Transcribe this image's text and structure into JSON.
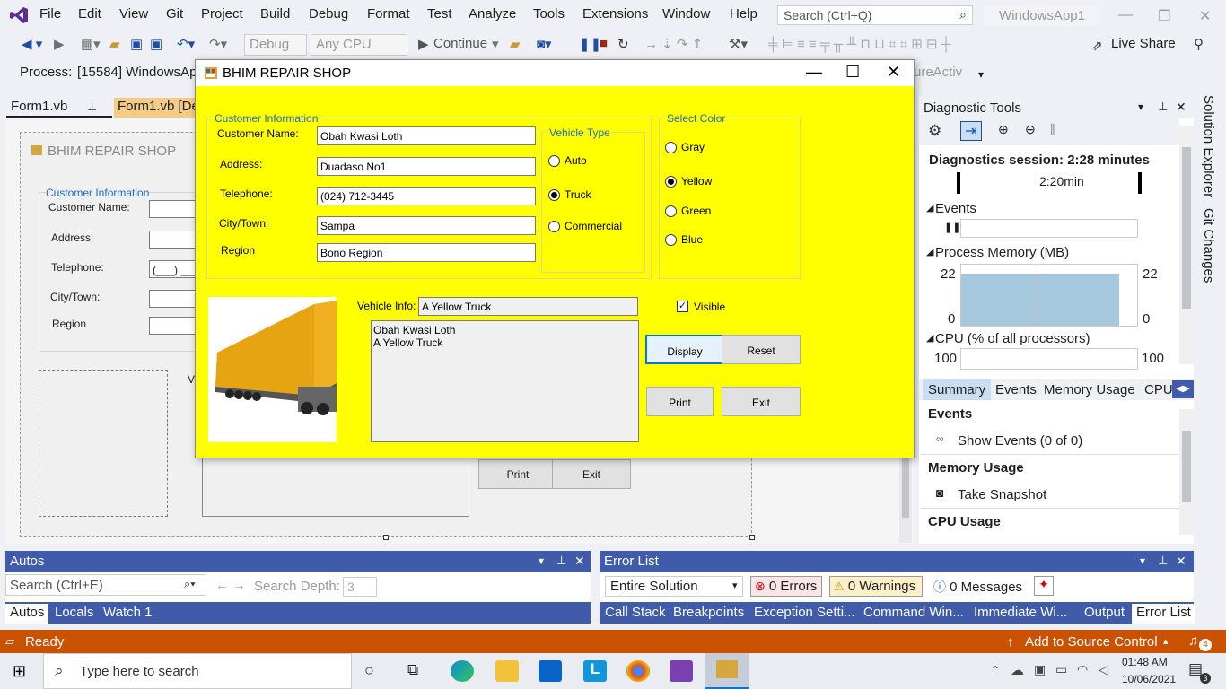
{
  "menubar": {
    "items": [
      "File",
      "Edit",
      "View",
      "Git",
      "Project",
      "Build",
      "Debug",
      "Format",
      "Test",
      "Analyze",
      "Tools",
      "Extensions",
      "Window",
      "Help"
    ],
    "search_placeholder": "Search (Ctrl+Q)",
    "solution_title": "WindowsApp1"
  },
  "toolbar": {
    "config": "Debug",
    "platform": "Any CPU",
    "continue_label": "Continue",
    "live_share": "Live Share",
    "app_insights": "ureActiv"
  },
  "process": {
    "label": "Process:",
    "value": "[15584] WindowsAp"
  },
  "doc_tabs": {
    "tab1": "Form1.vb",
    "tab2": "Form1.vb [De"
  },
  "designer": {
    "form_title": "BHIM REPAIR SHOP",
    "group_title": "Customer Information",
    "labels": [
      "Customer Name:",
      "Address:",
      "Telephone:",
      "City/Town:",
      "Region"
    ],
    "phone_mask": "(___) ___-",
    "vehicle_label_fragment": "Ve",
    "print_label": "Print",
    "exit_label": "Exit"
  },
  "dialog": {
    "title": "BHIM REPAIR SHOP",
    "customer_group": "Customer Information",
    "fields": [
      {
        "label": "Customer Name:",
        "value": "Obah Kwasi Loth"
      },
      {
        "label": "Address:",
        "value": "Duadaso No1"
      },
      {
        "label": "Telephone:",
        "value": "(024) 712-3445"
      },
      {
        "label": "City/Town:",
        "value": "Sampa"
      },
      {
        "label": "Region",
        "value": "Bono Region"
      }
    ],
    "vehicle_group": "Vehicle Type",
    "vehicle_types": [
      {
        "label": "Auto",
        "checked": false
      },
      {
        "label": "Truck",
        "checked": true
      },
      {
        "label": "Commercial",
        "checked": false
      }
    ],
    "color_group": "Select Color",
    "colors": [
      {
        "label": "Gray",
        "checked": false
      },
      {
        "label": "Yellow",
        "checked": true
      },
      {
        "label": "Green",
        "checked": false
      },
      {
        "label": "Blue",
        "checked": false
      }
    ],
    "vehicle_info_label": "Vehicle Info:",
    "vehicle_info_value": "A Yellow Truck",
    "visible_label": "Visible",
    "visible_checked": true,
    "output_lines": [
      "Obah Kwasi Loth",
      "A Yellow Truck"
    ],
    "buttons": {
      "display": "Display",
      "reset": "Reset",
      "print": "Print",
      "exit": "Exit"
    },
    "truck_color": "#f0b020"
  },
  "diagnostics": {
    "title": "Diagnostic Tools",
    "session": "Diagnostics session: 2:28 minutes",
    "timeline_mark": "2:20min",
    "events_label": "Events",
    "memory_label": "Process Memory (MB)",
    "memory_max": "22",
    "memory_min": "0",
    "cpu_label": "CPU (% of all processors)",
    "cpu_max": "100",
    "tabs": [
      "Summary",
      "Events",
      "Memory Usage",
      "CPU"
    ],
    "section_events": "Events",
    "show_events": "Show Events (0 of 0)",
    "section_memory": "Memory Usage",
    "take_snapshot": "Take Snapshot",
    "section_cpu": "CPU Usage",
    "side_tabs": [
      "Solution Explorer",
      "Git Changes"
    ]
  },
  "autos": {
    "title": "Autos",
    "search_placeholder": "Search (Ctrl+E)",
    "depth_label": "Search Depth:",
    "depth_value": "3",
    "tabs": [
      "Autos",
      "Locals",
      "Watch 1"
    ]
  },
  "errors": {
    "title": "Error List",
    "scope": "Entire Solution",
    "errors": "0 Errors",
    "warnings": "0 Warnings",
    "messages": "0 Messages",
    "tabs": [
      "Call Stack",
      "Breakpoints",
      "Exception Setti...",
      "Command Win...",
      "Immediate Wi...",
      "Output",
      "Error List"
    ]
  },
  "status": {
    "ready": "Ready",
    "source_control": "Add to Source Control",
    "notif_count": "4"
  },
  "taskbar": {
    "search_placeholder": "Type here to search",
    "time": "01:48 AM",
    "date": "10/06/2021",
    "notif": "3"
  }
}
